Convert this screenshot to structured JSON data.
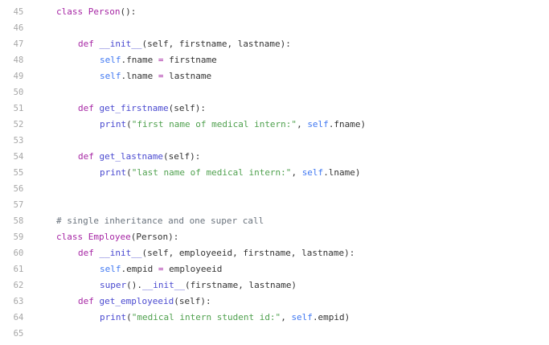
{
  "editor": {
    "language": "python",
    "lines": [
      {
        "num": "45",
        "indent": 0,
        "tokens": [
          [
            "kw",
            "class"
          ],
          [
            "txt",
            " "
          ],
          [
            "cls",
            "Person"
          ],
          [
            "txt",
            "():"
          ]
        ]
      },
      {
        "num": "46",
        "indent": 0,
        "tokens": []
      },
      {
        "num": "47",
        "indent": 1,
        "tokens": [
          [
            "kw",
            "def"
          ],
          [
            "txt",
            " "
          ],
          [
            "fn",
            "__init__"
          ],
          [
            "txt",
            "(self, firstname, lastname):"
          ]
        ]
      },
      {
        "num": "48",
        "indent": 2,
        "tokens": [
          [
            "self",
            "self"
          ],
          [
            "txt",
            ".fname "
          ],
          [
            "op",
            "="
          ],
          [
            "txt",
            " firstname"
          ]
        ]
      },
      {
        "num": "49",
        "indent": 2,
        "tokens": [
          [
            "self",
            "self"
          ],
          [
            "txt",
            ".lname "
          ],
          [
            "op",
            "="
          ],
          [
            "txt",
            " lastname"
          ]
        ]
      },
      {
        "num": "50",
        "indent": 0,
        "tokens": []
      },
      {
        "num": "51",
        "indent": 1,
        "tokens": [
          [
            "kw",
            "def"
          ],
          [
            "txt",
            " "
          ],
          [
            "fn",
            "get_firstname"
          ],
          [
            "txt",
            "(self):"
          ]
        ]
      },
      {
        "num": "52",
        "indent": 2,
        "tokens": [
          [
            "fn",
            "print"
          ],
          [
            "txt",
            "("
          ],
          [
            "str",
            "\"first name of medical intern:\""
          ],
          [
            "txt",
            ", "
          ],
          [
            "self",
            "self"
          ],
          [
            "txt",
            ".fname)"
          ]
        ]
      },
      {
        "num": "53",
        "indent": 0,
        "tokens": []
      },
      {
        "num": "54",
        "indent": 1,
        "tokens": [
          [
            "kw",
            "def"
          ],
          [
            "txt",
            " "
          ],
          [
            "fn",
            "get_lastname"
          ],
          [
            "txt",
            "(self):"
          ]
        ]
      },
      {
        "num": "55",
        "indent": 2,
        "tokens": [
          [
            "fn",
            "print"
          ],
          [
            "txt",
            "("
          ],
          [
            "str",
            "\"last name of medical intern:\""
          ],
          [
            "txt",
            ", "
          ],
          [
            "self",
            "self"
          ],
          [
            "txt",
            ".lname)"
          ]
        ]
      },
      {
        "num": "56",
        "indent": 0,
        "tokens": []
      },
      {
        "num": "57",
        "indent": 0,
        "tokens": []
      },
      {
        "num": "58",
        "indent": 0,
        "tokens": [
          [
            "cm",
            "# single inheritance and one super call"
          ]
        ]
      },
      {
        "num": "59",
        "indent": 0,
        "tokens": [
          [
            "kw",
            "class"
          ],
          [
            "txt",
            " "
          ],
          [
            "cls",
            "Employee"
          ],
          [
            "txt",
            "(Person):"
          ]
        ]
      },
      {
        "num": "60",
        "indent": 1,
        "tokens": [
          [
            "kw",
            "def"
          ],
          [
            "txt",
            " "
          ],
          [
            "fn",
            "__init__"
          ],
          [
            "txt",
            "(self, employeeid, firstname, lastname):"
          ]
        ]
      },
      {
        "num": "61",
        "indent": 2,
        "tokens": [
          [
            "self",
            "self"
          ],
          [
            "txt",
            ".empid "
          ],
          [
            "op",
            "="
          ],
          [
            "txt",
            " employeeid"
          ]
        ]
      },
      {
        "num": "62",
        "indent": 2,
        "tokens": [
          [
            "fn",
            "super"
          ],
          [
            "txt",
            "()."
          ],
          [
            "fn",
            "__init__"
          ],
          [
            "txt",
            "(firstname, lastname)"
          ]
        ]
      },
      {
        "num": "63",
        "indent": 1,
        "tokens": [
          [
            "kw",
            "def"
          ],
          [
            "txt",
            " "
          ],
          [
            "fn",
            "get_employeeid"
          ],
          [
            "txt",
            "(self):"
          ]
        ]
      },
      {
        "num": "64",
        "indent": 2,
        "tokens": [
          [
            "fn",
            "print"
          ],
          [
            "txt",
            "("
          ],
          [
            "str",
            "\"medical intern student id:\""
          ],
          [
            "txt",
            ", "
          ],
          [
            "self",
            "self"
          ],
          [
            "txt",
            ".empid)"
          ]
        ]
      },
      {
        "num": "65",
        "indent": 0,
        "tokens": []
      }
    ]
  }
}
